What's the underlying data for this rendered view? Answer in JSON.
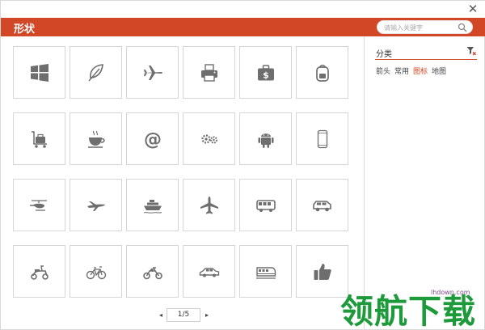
{
  "window": {
    "close_glyph": "✕"
  },
  "header": {
    "title": "形状"
  },
  "search": {
    "placeholder": "请输入关键字"
  },
  "sidebar": {
    "category_label": "分类",
    "options": [
      {
        "label": "箭头",
        "active": false
      },
      {
        "label": "常用",
        "active": false
      },
      {
        "label": "图标",
        "active": true
      },
      {
        "label": "地图",
        "active": false
      }
    ]
  },
  "gallery": {
    "icons": [
      "windows-logo-icon",
      "leaf-icon",
      "airplane-icon",
      "printer-icon",
      "money-bag-icon",
      "backpack-icon",
      "luggage-cart-icon",
      "coffee-cup-icon",
      "at-sign-icon",
      "gears-icon",
      "android-icon",
      "smartphone-icon",
      "helicopter-icon",
      "jet-icon",
      "cruise-ship-icon",
      "plane-icon",
      "bus-icon",
      "suv-car-icon",
      "scooter-icon",
      "bicycle-icon",
      "motorcycle-icon",
      "sedan-car-icon",
      "train-icon",
      "thumbs-up-icon"
    ]
  },
  "pager": {
    "prev": "◂",
    "next": "▸",
    "current": "1/5"
  },
  "watermark": {
    "url": "lhdown.com",
    "text": "领航下载"
  },
  "colors": {
    "accent": "#d24726",
    "icon_gray": "#6e6e6e",
    "watermark_green": "#1d9a3a"
  }
}
